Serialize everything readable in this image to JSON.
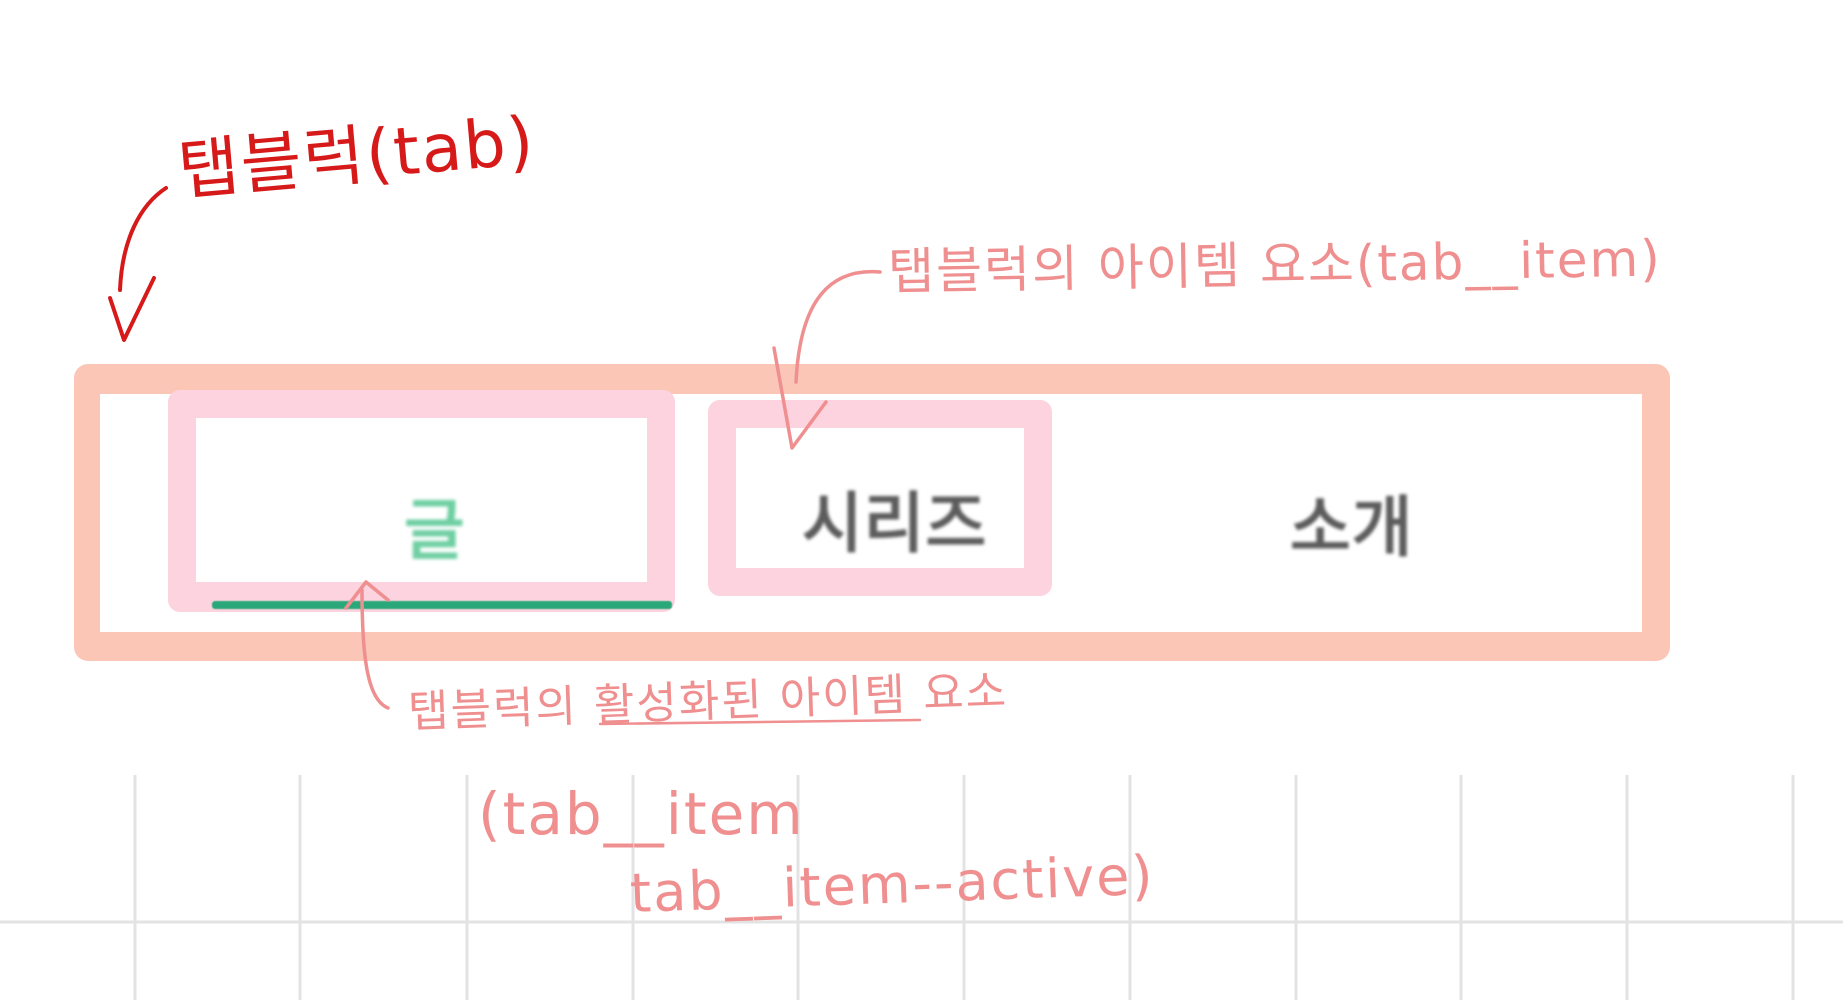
{
  "annotations": {
    "tab_block_label": "탭블럭(tab)",
    "tab_item_label": "탭블럭의 아이템 요소(tab__item)",
    "active_item_label": "탭블럭의 활성화된 아이템 요소",
    "active_class_line1": "(tab__item",
    "active_class_line2": "tab__item--active)"
  },
  "tabs": [
    {
      "label": "글",
      "active": true
    },
    {
      "label": "시리즈",
      "active": false
    },
    {
      "label": "소개",
      "active": false
    }
  ],
  "colors": {
    "annotation_red": "#d61a1a",
    "annotation_pink": "#ef8f8f",
    "tab_block_outline": "#fbc6b6",
    "tab_item_outline": "#fcd3df",
    "active_text": "#6fcfa3",
    "active_indicator": "#2aa879",
    "inactive_text": "#5c5c5c",
    "grid_line": "#e3e3e3"
  },
  "icons": [
    "hand-drawn-arrow-icon"
  ]
}
